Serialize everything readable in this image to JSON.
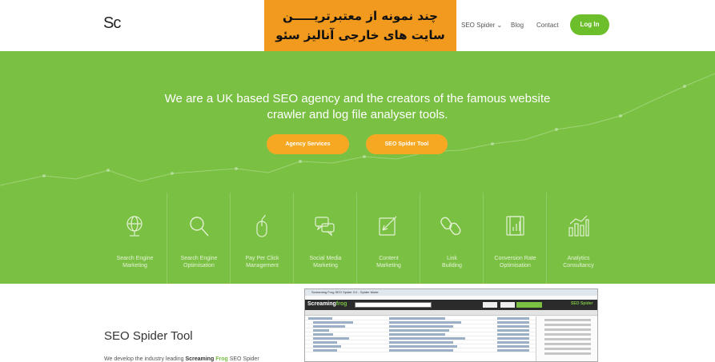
{
  "header": {
    "logo_text": "Sc",
    "nav": {
      "seo_spider": "SEO Spider ⌄",
      "blog": "Blog",
      "contact": "Contact"
    },
    "login_label": "Log In"
  },
  "overlay": {
    "line1": "چند نمونه از معتبرتریـــــن",
    "line2": "سایت های خارجی آنالیز سئو"
  },
  "hero": {
    "tagline_line1": "We are a UK based SEO agency and the creators of the famous website",
    "tagline_line2": "crawler and log file analyser tools.",
    "buttons": {
      "agency": "Agency Services",
      "spider": "SEO Spider Tool"
    }
  },
  "services": [
    {
      "line1": "Search Engine",
      "line2": "Marketing",
      "icon": "globe-icon"
    },
    {
      "line1": "Search Engine",
      "line2": "Optimisation",
      "icon": "magnifier-icon"
    },
    {
      "line1": "Pay Per Click",
      "line2": "Management",
      "icon": "mouse-icon"
    },
    {
      "line1": "Social Media",
      "line2": "Marketing",
      "icon": "chat-bubbles-icon"
    },
    {
      "line1": "Content",
      "line2": "Marketing",
      "icon": "pencil-paper-icon"
    },
    {
      "line1": "Link",
      "line2": "Building",
      "icon": "chain-link-icon"
    },
    {
      "line1": "Conversion Rate",
      "line2": "Optimisation",
      "icon": "document-chart-icon"
    },
    {
      "line1": "Analytics",
      "line2": "Consultancy",
      "icon": "bar-chart-icon"
    }
  ],
  "bottom": {
    "title": "SEO Spider Tool",
    "text_start": "We develop the industry leading ",
    "text_bold": "Screaming ",
    "text_frog": "Frog",
    "text_end": " SEO Spider"
  },
  "screenshot": {
    "title": "Screaming Frog SEO Spider 3.0 - Spider Mode",
    "logo_a": "Scream",
    "logo_b": "ing",
    "logo_c": "frog",
    "spider_tag": "SEO Spider"
  },
  "colors": {
    "brand_green": "#7ac143",
    "button_orange": "#f7a823",
    "overlay_orange": "#f29a1e"
  }
}
